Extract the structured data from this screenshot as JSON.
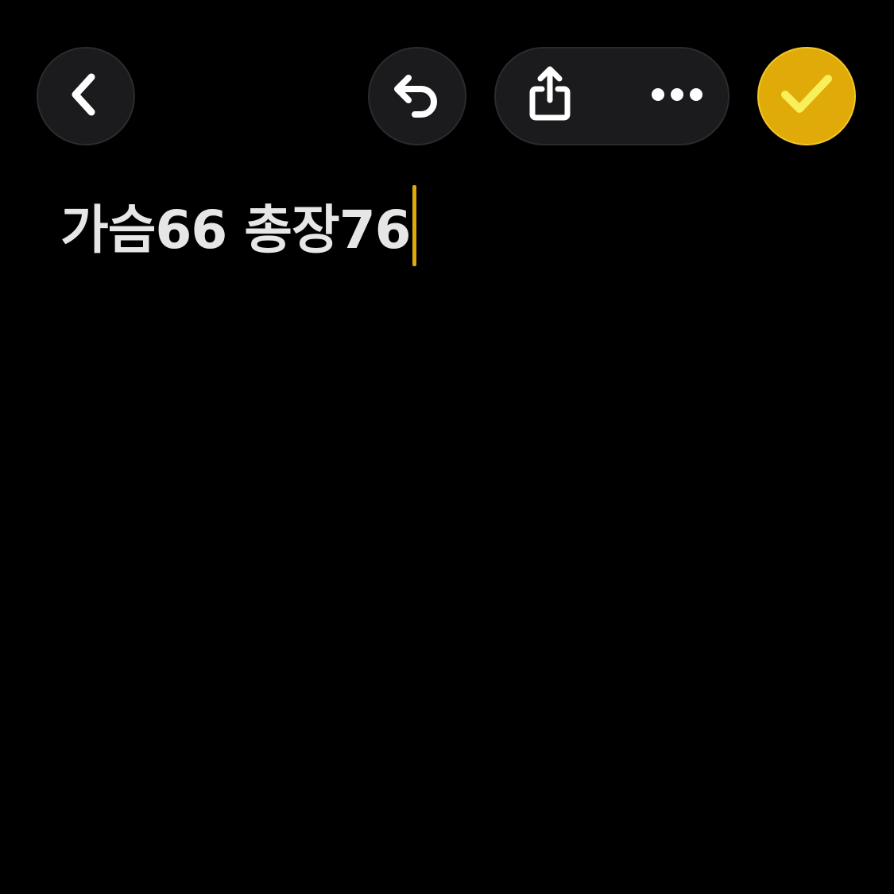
{
  "toolbar": {
    "back_icon": "chevron-left-icon",
    "undo_icon": "undo-arrow-icon",
    "share_icon": "share-icon",
    "more_icon": "more-horizontal-icon",
    "done_icon": "checkmark-icon"
  },
  "note": {
    "text": "가슴66 총장76"
  },
  "colors": {
    "background": "#000000",
    "button": "#1b1b1d",
    "accent": "#e0ab08",
    "check": "#f7f05a",
    "text": "#e6e6e6"
  }
}
